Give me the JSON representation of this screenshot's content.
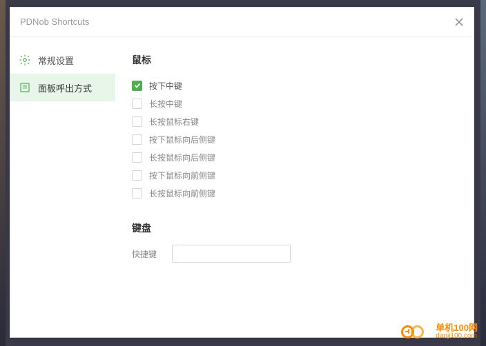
{
  "window": {
    "title": "PDNob Shortcuts"
  },
  "sidebar": {
    "items": [
      {
        "label": "常规设置",
        "active": false
      },
      {
        "label": "面板呼出方式",
        "active": true
      }
    ]
  },
  "content": {
    "mouse_title": "鼠标",
    "mouse_options": [
      {
        "label": "按下中键",
        "checked": true
      },
      {
        "label": "长按中键",
        "checked": false
      },
      {
        "label": "长按鼠标右键",
        "checked": false
      },
      {
        "label": "按下鼠标向后侧键",
        "checked": false
      },
      {
        "label": "长按鼠标向后侧键",
        "checked": false
      },
      {
        "label": "按下鼠标向前侧键",
        "checked": false
      },
      {
        "label": "长按鼠标向前侧键",
        "checked": false
      }
    ],
    "keyboard_title": "键盘",
    "shortcut_label": "快捷键",
    "shortcut_value": ""
  },
  "watermark": {
    "name": "单机100网",
    "url": "danji100.com"
  }
}
